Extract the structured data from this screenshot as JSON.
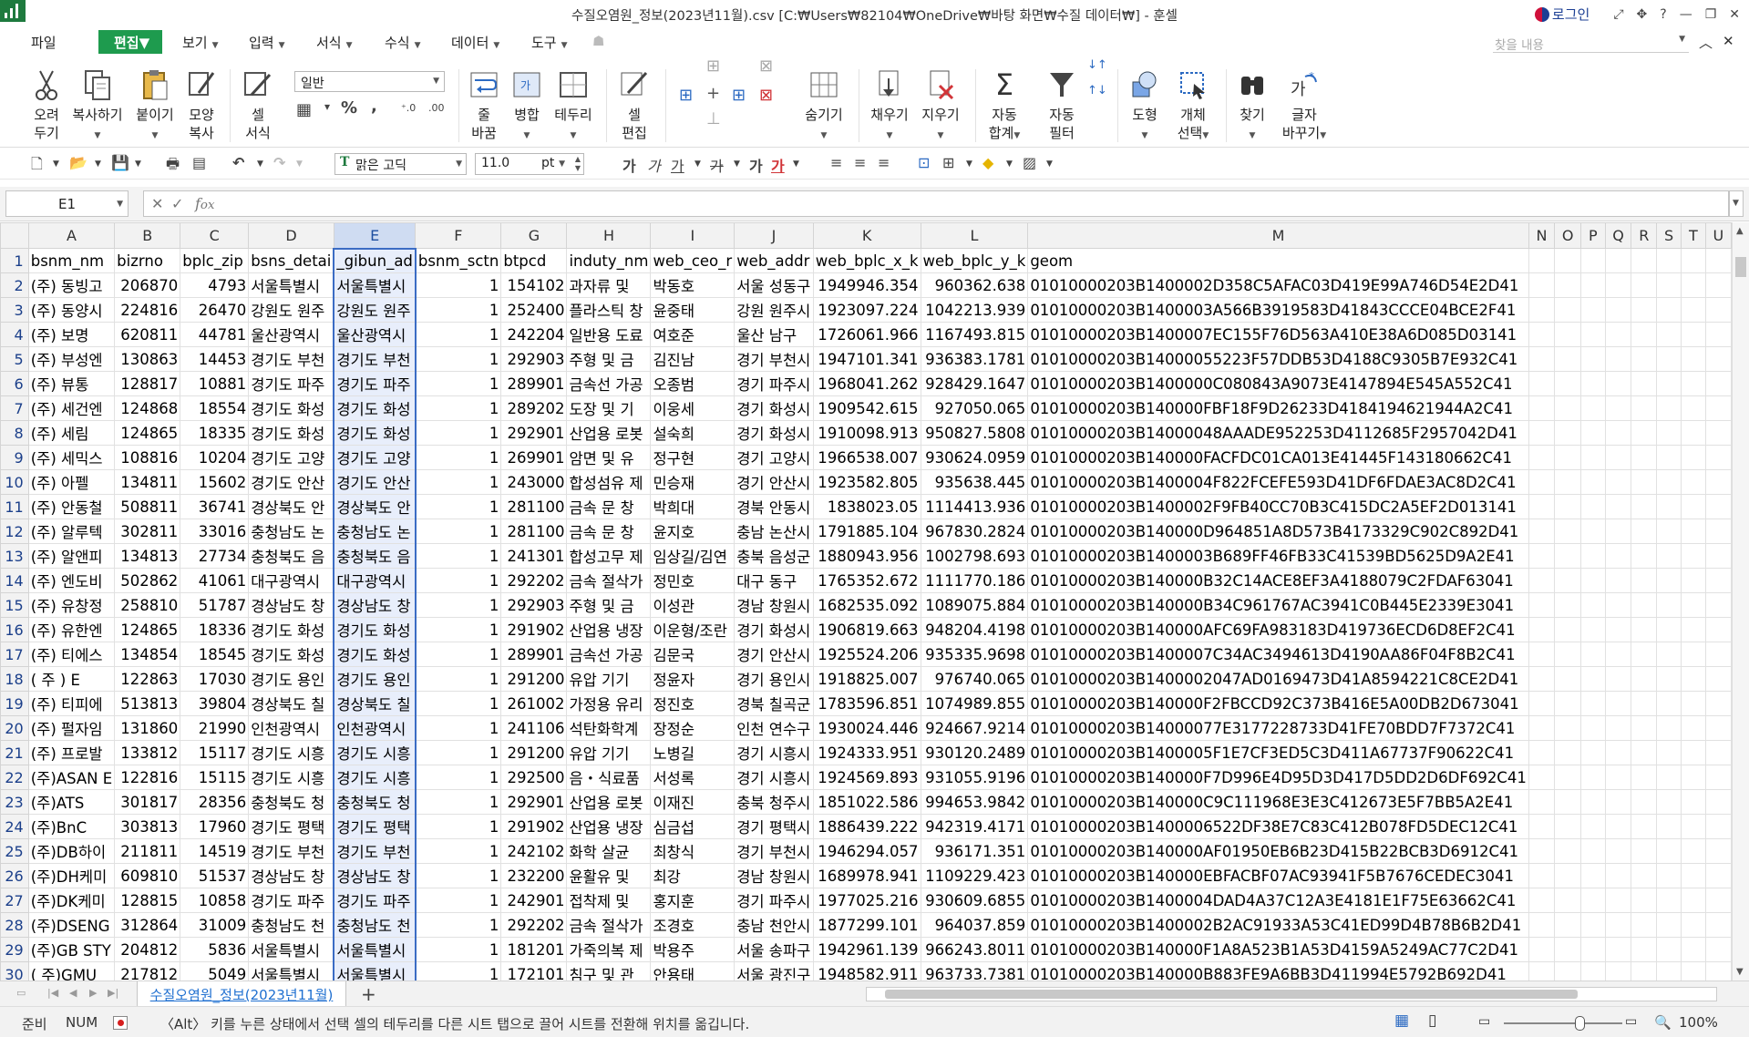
{
  "window": {
    "title": "수질오염원_정보(2023년11월).csv [C:₩Users₩82104₩OneDrive₩바탕 화면₩수질 데이터₩] - 훈셀",
    "login": "로그인"
  },
  "menu": {
    "items": [
      "파일",
      "편집",
      "보기",
      "입력",
      "서식",
      "수식",
      "데이터",
      "도구"
    ],
    "find_placeholder": "찾을 내용"
  },
  "ribbon": {
    "cut": [
      "오려",
      "두기"
    ],
    "copy": "복사하기",
    "paste": "붙이기",
    "format_copy": [
      "모양",
      "복사"
    ],
    "cell_format": [
      "셀",
      "서식"
    ],
    "number_format": "일반",
    "wrap": [
      "줄",
      "바꿈"
    ],
    "merge": "병합",
    "border": "테두리",
    "cell_edit": [
      "셀",
      "편집"
    ],
    "hide": "숨기기",
    "fill": "채우기",
    "clear": "지우기",
    "autosum": [
      "자동",
      "합계"
    ],
    "autofilter": [
      "자동",
      "필터"
    ],
    "shape": "도형",
    "object_select": [
      "개체",
      "선택"
    ],
    "find": "찾기",
    "replace": [
      "글자",
      "바꾸기"
    ]
  },
  "toolbar": {
    "font": "맑은 고딕",
    "font_size": "11.0",
    "size_unit": "pt"
  },
  "formula_bar": {
    "name_box": "E1",
    "formula": ""
  },
  "sheet": {
    "columns": [
      "A",
      "B",
      "C",
      "D",
      "E",
      "F",
      "G",
      "H",
      "I",
      "J",
      "K",
      "L",
      "M",
      "N",
      "O",
      "P",
      "Q",
      "R",
      "S",
      "T",
      "U"
    ],
    "selected_column": "E",
    "rows": [
      [
        "1",
        "bsnm_nm",
        "bizrno",
        "bplc_zip",
        "bsns_detai",
        "_gibun_ad",
        "bsnm_sctn",
        "btpcd",
        "induty_nm",
        "web_ceo_r",
        "web_addr",
        "web_bplc_x_k",
        "web_bplc_y_k",
        "geom"
      ],
      [
        "2",
        "(주) 동빙고",
        "206870",
        "4793",
        "서울특별시",
        "서울특별시",
        "1",
        "154102",
        "과자류 및",
        "박동호",
        "서울 성동구",
        "1949946.354",
        "960362.638",
        "01010000203B1400002D358C5AFAC03D419E99A746D54E2D41"
      ],
      [
        "3",
        "(주) 동양시",
        "224816",
        "26470",
        "강원도 원주",
        "강원도 원주",
        "1",
        "252400",
        "플라스틱 창",
        "윤중태",
        "강원 원주시",
        "1923097.224",
        "1042213.939",
        "01010000203B1400003A566B3919583D41843CCCE04BCE2F41"
      ],
      [
        "4",
        "(주) 보명",
        "620811",
        "44781",
        "울산광역시",
        "울산광역시",
        "1",
        "242204",
        "일반용 도료",
        "여호준",
        "울산 남구",
        "1726061.966",
        "1167493.815",
        "01010000203B1400007EC155F76D563A410E38A6D085D03141"
      ],
      [
        "5",
        "(주) 부성엔",
        "130863",
        "14453",
        "경기도 부천",
        "경기도 부천",
        "1",
        "292903",
        "주형 및 금",
        "김진남",
        "경기 부천시",
        "1947101.341",
        "936383.1781",
        "01010000203B14000055223F57DDB53D4188C9305B7E932C41"
      ],
      [
        "6",
        "(주) 뷰통",
        "128817",
        "10881",
        "경기도 파주",
        "경기도 파주",
        "1",
        "289901",
        "금속선 가공",
        "오종범",
        "경기 파주시",
        "1968041.262",
        "928429.1647",
        "01010000203B1400000C080843A9073E4147894E545A552C41"
      ],
      [
        "7",
        "(주) 세건엔",
        "124868",
        "18554",
        "경기도 화성",
        "경기도 화성",
        "1",
        "289202",
        "도장 및 기",
        "이웅세",
        "경기 화성시",
        "1909542.615",
        "927050.065",
        "01010000203B140000FBF18F9D26233D4184194621944A2C41"
      ],
      [
        "8",
        "(주) 세림",
        "124865",
        "18335",
        "경기도 화성",
        "경기도 화성",
        "1",
        "292901",
        "산업용 로봇",
        "설숙희",
        "경기 화성시",
        "1910098.913",
        "950827.5808",
        "01010000203B14000048AAADE952253D4112685F2957042D41"
      ],
      [
        "9",
        "(주) 세믹스",
        "108816",
        "10204",
        "경기도 고양",
        "경기도 고양",
        "1",
        "269901",
        "암면 및 유",
        "정구현",
        "경기 고양시",
        "1966538.007",
        "930624.0959",
        "01010000203B140000FACFDC01CA013E41445F143180662C41"
      ],
      [
        "10",
        "(주) 아펠",
        "134811",
        "15602",
        "경기도 안산",
        "경기도 안산",
        "1",
        "243000",
        "합성섬유 제",
        "민승재",
        "경기 안산시",
        "1923582.805",
        "935638.445",
        "01010000203B1400004F822FCEFE593D41DF6FDAE3AC8D2C41"
      ],
      [
        "11",
        "(주) 안동철",
        "508811",
        "36741",
        "경상북도 안",
        "경상북도 안",
        "1",
        "281100",
        "금속 문 창",
        "박희대",
        "경북 안동시",
        "1838023.05",
        "1114413.936",
        "01010000203B1400002F9FB40CC70B3C415DC2A5EF2D013141"
      ],
      [
        "12",
        "(주) 알루텍",
        "302811",
        "33016",
        "충청남도 논",
        "충청남도 논",
        "1",
        "281100",
        "금속 문 창",
        "윤지호",
        "충남 논산시",
        "1791885.104",
        "967830.2824",
        "01010000203B140000D964851A8D573B4173329C902C892D41"
      ],
      [
        "13",
        "(주) 알앤피",
        "134813",
        "27734",
        "충청북도 음",
        "충청북도 음",
        "1",
        "241301",
        "합성고무 제",
        "임상길/김연",
        "충북 음성군",
        "1880943.956",
        "1002798.693",
        "01010000203B1400003B689FF46FB33C41539BD5625D9A2E41"
      ],
      [
        "14",
        "(주) 엔도비",
        "502862",
        "41061",
        "대구광역시",
        "대구광역시",
        "1",
        "292202",
        "금속 절삭가",
        "정민호",
        "대구 동구",
        "1765352.672",
        "1111770.186",
        "01010000203B140000B32C14ACE8EF3A4188079C2FDAF63041"
      ],
      [
        "15",
        "(주) 유창정",
        "258810",
        "51787",
        "경상남도 창",
        "경상남도 창",
        "1",
        "292903",
        "주형 및 금",
        "이성관",
        "경남 창원시",
        "1682535.092",
        "1089075.884",
        "01010000203B140000B34C961767AC3941C0B445E2339E3041"
      ],
      [
        "16",
        "(주) 유한엔",
        "124865",
        "18336",
        "경기도 화성",
        "경기도 화성",
        "1",
        "291902",
        "산업용 냉장",
        "이운형/조란",
        "경기 화성시",
        "1906819.663",
        "948204.4198",
        "01010000203B140000AFC69FA983183D419736ECD6D8EF2C41"
      ],
      [
        "17",
        "(주) 티에스",
        "134854",
        "18545",
        "경기도 화성",
        "경기도 화성",
        "1",
        "289901",
        "금속선 가공",
        "김문국",
        "경기 안산시",
        "1925524.206",
        "935335.9698",
        "01010000203B1400007C34AC3494613D4190AA86F04F8B2C41"
      ],
      [
        "18",
        "( 주 )  E",
        "122863",
        "17030",
        "경기도 용인",
        "경기도 용인",
        "1",
        "291200",
        "유압 기기",
        "정윤자",
        "경기 용인시",
        "1918825.007",
        "976740.065",
        "01010000203B1400002047AD0169473D41A8594221C8CE2D41"
      ],
      [
        "19",
        "(주) 티피에",
        "513813",
        "39804",
        "경상북도 칠",
        "경상북도 칠",
        "1",
        "261002",
        "가정용 유리",
        "정진호",
        "경북 칠곡군",
        "1783596.851",
        "1074989.855",
        "01010000203B140000F2FBCCD92C373B416E5A00DB2D673041"
      ],
      [
        "20",
        "(주) 펄자임",
        "131860",
        "21990",
        "인천광역시",
        "인천광역시",
        "1",
        "241106",
        "석탄화학계",
        "장정순",
        "인천 연수구",
        "1930024.446",
        "924667.9214",
        "01010000203B14000077E3177228733D41FE70BDD7F7372C41"
      ],
      [
        "21",
        "(주) 프로발",
        "133812",
        "15117",
        "경기도 시흥",
        "경기도 시흥",
        "1",
        "291200",
        "유압 기기",
        "노병길",
        "경기 시흥시",
        "1924333.951",
        "930120.2489",
        "01010000203B1400005F1E7CF3ED5C3D411A67737F90622C41"
      ],
      [
        "22",
        "(주)ASAN E",
        "122816",
        "15115",
        "경기도 시흥",
        "경기도 시흥",
        "1",
        "292500",
        "음・식료품",
        "서성록",
        "경기 시흥시",
        "1924569.893",
        "931055.9196",
        "01010000203B140000F7D996E4D95D3D417D5DD2D6DF692C41"
      ],
      [
        "23",
        "(주)ATS",
        "301817",
        "28356",
        "충청북도 청",
        "충청북도 청",
        "1",
        "292901",
        "산업용 로봇",
        "이재진",
        "충북 청주시",
        "1851022.586",
        "994653.9842",
        "01010000203B140000C9C111968E3E3C412673E5F7BB5A2E41"
      ],
      [
        "24",
        "(주)BnC",
        "303813",
        "17960",
        "경기도 평택",
        "경기도 평택",
        "1",
        "291902",
        "산업용 냉장",
        "심금섭",
        "경기 평택시",
        "1886439.222",
        "942319.4171",
        "01010000203B1400006522DF38E7C83C412B078FD5DEC12C41"
      ],
      [
        "25",
        "(주)DB하이",
        "211811",
        "14519",
        "경기도 부천",
        "경기도 부천",
        "1",
        "242102",
        "화학 살균",
        "최창식",
        "경기 부천시",
        "1946294.057",
        "936171.351",
        "01010000203B140000AF01950EB6B23D415B22BCB3D6912C41"
      ],
      [
        "26",
        "(주)DH케미",
        "609810",
        "51537",
        "경상남도 창",
        "경상남도 창",
        "1",
        "232200",
        "윤활유 및",
        "최강",
        "경남 창원시",
        "1689978.941",
        "1109229.423",
        "01010000203B140000EBFACBF07AC93941F5B7676CEDEC3041"
      ],
      [
        "27",
        "(주)DK케미",
        "128815",
        "10858",
        "경기도 파주",
        "경기도 파주",
        "1",
        "242901",
        "접착제 및",
        "홍지훈",
        "경기 파주시",
        "1977025.216",
        "930609.6855",
        "01010000203B1400004DAD4A37C12A3E4181E1F75E63662C41"
      ],
      [
        "28",
        "(주)DSENG",
        "312864",
        "31009",
        "충청남도 천",
        "충청남도 천",
        "1",
        "292202",
        "금속 절삭가",
        "조경호",
        "충남 천안시",
        "1877299.101",
        "964037.859",
        "01010000203B1400002B2AC91933A53C41ED99D4B78B6B2D41"
      ],
      [
        "29",
        "(주)GB STY",
        "204812",
        "5836",
        "서울특별시",
        "서울특별시",
        "1",
        "181201",
        "가죽의복 제",
        "박용주",
        "서울 송파구",
        "1942961.139",
        "966243.8011",
        "01010000203B140000F1A8A523B1A53D4159A5249AC77C2D41"
      ],
      [
        "30",
        "( 주)GMU",
        "217812",
        "5049",
        "서울특별시",
        "서울특별시",
        "1",
        "172101",
        "침구 및 관",
        "안용태",
        "서울 광진구",
        "1948582.911",
        "963733.7381",
        "01010000203B140000B883FE9A6BB3D411994E5792B692D41"
      ]
    ]
  },
  "tabs": {
    "active": "수질오염원_정보(2023년11월)"
  },
  "status": {
    "mode": "준비",
    "num": "NUM",
    "hint": "〈Alt〉 키를 누른 상태에서 선택 셀의 테두리를 다른 시트 탭으로 끌어 시트를 전환해 위치를 옮깁니다.",
    "zoom": "100%",
    "zoom_level": 1.0
  }
}
